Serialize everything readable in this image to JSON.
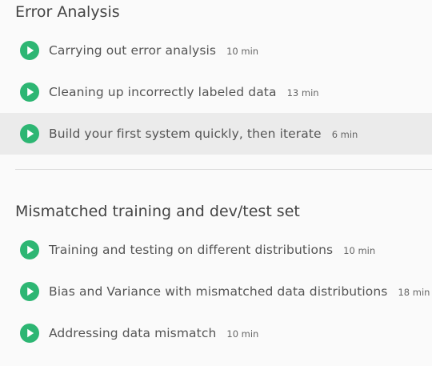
{
  "colors": {
    "background": "#fafafa",
    "active_row": "#ebebeb",
    "play_icon": "#2db673",
    "divider": "#dcdcdc"
  },
  "sections": [
    {
      "title": "Error Analysis",
      "lessons": [
        {
          "icon": "play-circle-icon",
          "title": "Carrying out error analysis",
          "duration": "10 min"
        },
        {
          "icon": "play-circle-icon",
          "title": "Cleaning up incorrectly labeled data",
          "duration": "13 min"
        },
        {
          "icon": "play-circle-icon",
          "title": "Build your first system quickly, then iterate",
          "duration": "6 min",
          "active": true
        }
      ]
    },
    {
      "title": "Mismatched training and dev/test set",
      "lessons": [
        {
          "icon": "play-circle-icon",
          "title": "Training and testing on different distributions",
          "duration": "10 min"
        },
        {
          "icon": "play-circle-icon",
          "title": "Bias and Variance with mismatched data distributions",
          "duration": "18 min"
        },
        {
          "icon": "play-circle-icon",
          "title": "Addressing data mismatch",
          "duration": "10 min"
        }
      ]
    }
  ]
}
